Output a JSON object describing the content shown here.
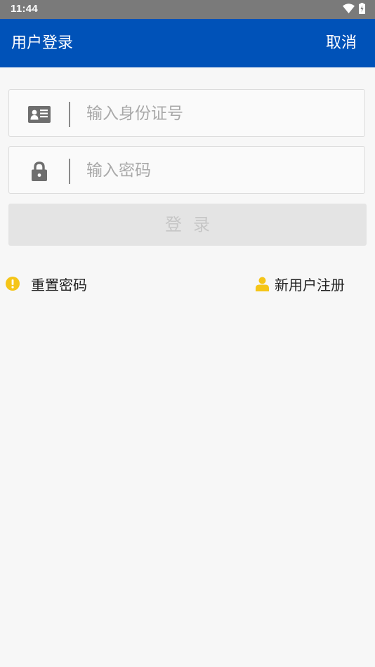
{
  "status_bar": {
    "time": "11:44",
    "wifi_icon": "wifi-icon",
    "battery_icon": "battery-charging-icon"
  },
  "app_bar": {
    "title": "用户登录",
    "cancel_label": "取消",
    "color": "#0052b8"
  },
  "form": {
    "id_field": {
      "icon": "id-card-icon",
      "placeholder": "输入身份证号",
      "value": ""
    },
    "password_field": {
      "icon": "lock-icon",
      "placeholder": "输入密码",
      "value": ""
    },
    "login_label": "登录"
  },
  "links": {
    "reset_password": {
      "icon": "warning-icon",
      "label": "重置密码"
    },
    "register": {
      "icon": "user-icon",
      "label": "新用户注册"
    },
    "icon_color": "#f5c518"
  }
}
